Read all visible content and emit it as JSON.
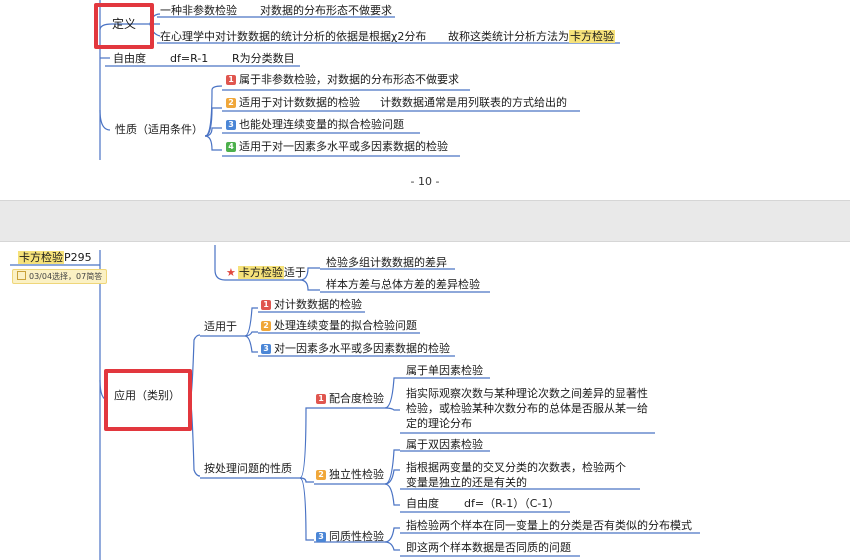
{
  "page1": {
    "def_label": "定义",
    "def_items": [
      "一种非参数检验",
      "对数据的分布形态不做要求",
      "在心理学中对计数数据的统计分析的依据是根据χ2分布",
      "故称这类统计分析方法为",
      "卡方检验"
    ],
    "dof_label": "自由度",
    "dof_formula": "df=R-1",
    "dof_note": "R为分类数目",
    "props_label": "性质（适用条件）",
    "props": [
      {
        "n": "1",
        "text": "属于非参数检验，对数据的分布形态不做要求"
      },
      {
        "n": "2",
        "text": "适用于对计数数据的检验",
        "extra": "计数数据通常是用列联表的方式给出的"
      },
      {
        "n": "3",
        "text": "也能处理连续变量的拟合检验问题"
      },
      {
        "n": "4",
        "text": "适用于对一因素多水平或多因素数据的检验"
      }
    ],
    "page_number": "- 10 -"
  },
  "page2": {
    "root_hl": "卡方检验",
    "root_suffix": "P295",
    "note": "03/04选择，07简答",
    "chi_hl": "卡方检验",
    "chi_suffix": "适于",
    "chi_items": [
      "检验多组计数数据的差异",
      "样本方差与总体方差的差异检验"
    ],
    "app_label": "应用（类别）",
    "suit_label": "适用于",
    "suit_items": [
      {
        "n": "1",
        "text": "对计数数据的检验"
      },
      {
        "n": "2",
        "text": "处理连续变量的拟合检验问题"
      },
      {
        "n": "3",
        "text": "对一因素多水平或多因素数据的检验"
      }
    ],
    "nature_label": "按处理问题的性质",
    "fit": {
      "n": "1",
      "label": "配合度检验",
      "items": [
        "属于单因素检验",
        "指实际观察次数与某种理论次数之间差异的显著性检验，或检验某种次数分布的总体是否服从某一给定的理论分布"
      ]
    },
    "indep": {
      "n": "2",
      "label": "独立性检验",
      "items": [
        "属于双因素检验",
        "指根据两变量的交叉分类的次数表，检验两个变量是独立的还是有关的"
      ],
      "dof_label": "自由度",
      "dof_formula": "df=（R-1）（C-1）"
    },
    "homog": {
      "n": "3",
      "label": "同质性检验",
      "items": [
        "指检验两个样本在同一变量上的分类是否有类似的分布模式",
        "即这两个样本数据是否同质的问题"
      ]
    }
  },
  "colors": {
    "line": "#4a73c4",
    "red": "#e2373e",
    "n1": "#e0564f",
    "n2": "#f0a73a",
    "n3": "#4b86d6",
    "n4": "#4cb04c"
  }
}
